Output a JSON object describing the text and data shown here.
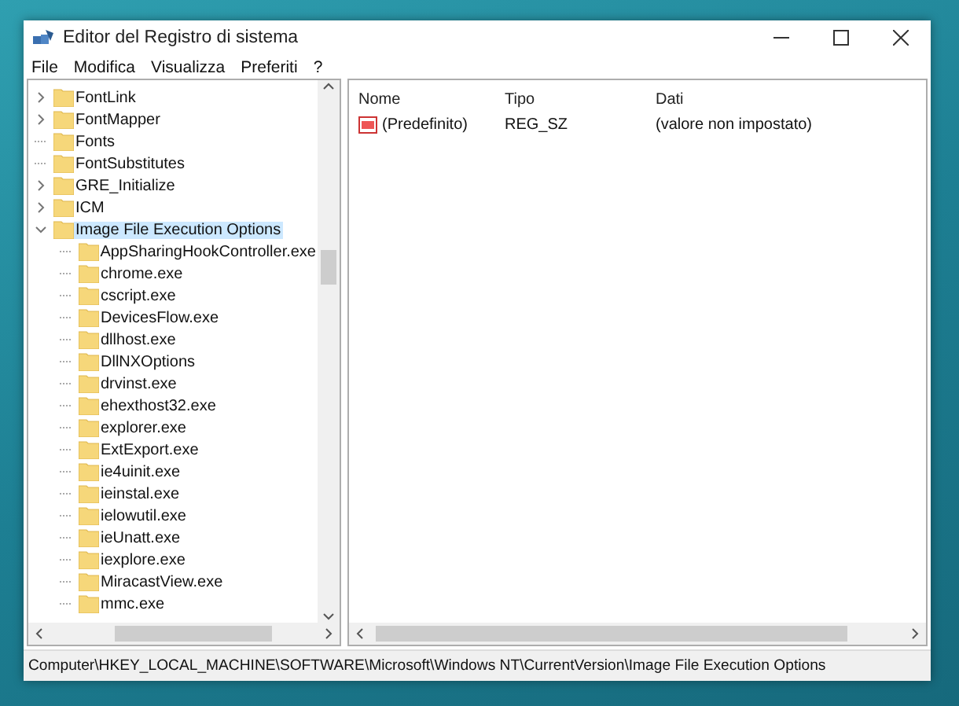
{
  "window": {
    "title": "Editor del Registro di sistema"
  },
  "menu": [
    "File",
    "Modifica",
    "Visualizza",
    "Preferiti",
    "?"
  ],
  "tree": [
    {
      "label": "FontLink",
      "expanded": false,
      "selected": false
    },
    {
      "label": "FontMapper",
      "expanded": false,
      "selected": false
    },
    {
      "label": "Fonts",
      "selected": false
    },
    {
      "label": "FontSubstitutes",
      "selected": false
    },
    {
      "label": "GRE_Initialize",
      "expanded": false,
      "selected": false
    },
    {
      "label": "ICM",
      "expanded": false,
      "selected": false
    },
    {
      "label": "Image File Execution Options",
      "expanded": true,
      "selected": true,
      "children": [
        {
          "label": "AppSharingHookController.exe",
          "selected": false
        },
        {
          "label": "chrome.exe",
          "selected": false
        },
        {
          "label": "cscript.exe",
          "selected": false
        },
        {
          "label": "DevicesFlow.exe",
          "selected": false
        },
        {
          "label": "dllhost.exe",
          "selected": false
        },
        {
          "label": "DllNXOptions",
          "selected": false
        },
        {
          "label": "drvinst.exe",
          "selected": false
        },
        {
          "label": "ehexthost32.exe",
          "selected": false
        },
        {
          "label": "explorer.exe",
          "selected": false
        },
        {
          "label": "ExtExport.exe",
          "selected": false
        },
        {
          "label": "ie4uinit.exe",
          "selected": false
        },
        {
          "label": "ieinstal.exe",
          "selected": false
        },
        {
          "label": "ielowutil.exe",
          "selected": false
        },
        {
          "label": "ieUnatt.exe",
          "selected": false
        },
        {
          "label": "iexplore.exe",
          "selected": false
        },
        {
          "label": "MiracastView.exe",
          "selected": false
        },
        {
          "label": "mmc.exe",
          "selected": false
        }
      ]
    }
  ],
  "values": {
    "columns": [
      "Nome",
      "Tipo",
      "Dati"
    ],
    "rows": [
      {
        "name": "(Predefinito)",
        "type": "REG_SZ",
        "data": "(valore non impostato)"
      }
    ]
  },
  "status_bar": "Computer\\HKEY_LOCAL_MACHINE\\SOFTWARE\\Microsoft\\Windows NT\\CurrentVersion\\Image File Execution Options"
}
